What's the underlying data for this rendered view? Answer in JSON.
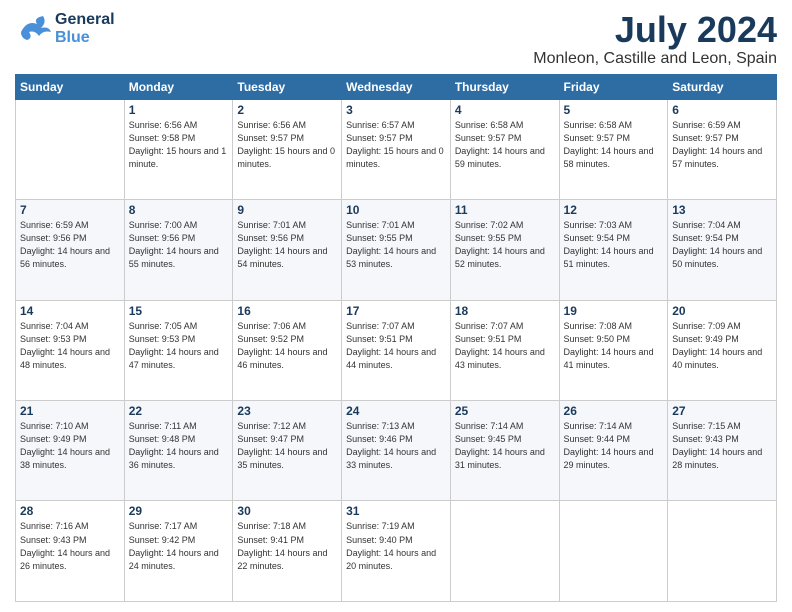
{
  "header": {
    "logo_general": "General",
    "logo_blue": "Blue",
    "month_year": "July 2024",
    "location": "Monleon, Castille and Leon, Spain"
  },
  "days_header": [
    "Sunday",
    "Monday",
    "Tuesday",
    "Wednesday",
    "Thursday",
    "Friday",
    "Saturday"
  ],
  "weeks": [
    [
      {
        "day": "",
        "sunrise": "",
        "sunset": "",
        "daylight": ""
      },
      {
        "day": "1",
        "sunrise": "Sunrise: 6:56 AM",
        "sunset": "Sunset: 9:58 PM",
        "daylight": "Daylight: 15 hours and 1 minute."
      },
      {
        "day": "2",
        "sunrise": "Sunrise: 6:56 AM",
        "sunset": "Sunset: 9:57 PM",
        "daylight": "Daylight: 15 hours and 0 minutes."
      },
      {
        "day": "3",
        "sunrise": "Sunrise: 6:57 AM",
        "sunset": "Sunset: 9:57 PM",
        "daylight": "Daylight: 15 hours and 0 minutes."
      },
      {
        "day": "4",
        "sunrise": "Sunrise: 6:58 AM",
        "sunset": "Sunset: 9:57 PM",
        "daylight": "Daylight: 14 hours and 59 minutes."
      },
      {
        "day": "5",
        "sunrise": "Sunrise: 6:58 AM",
        "sunset": "Sunset: 9:57 PM",
        "daylight": "Daylight: 14 hours and 58 minutes."
      },
      {
        "day": "6",
        "sunrise": "Sunrise: 6:59 AM",
        "sunset": "Sunset: 9:57 PM",
        "daylight": "Daylight: 14 hours and 57 minutes."
      }
    ],
    [
      {
        "day": "7",
        "sunrise": "Sunrise: 6:59 AM",
        "sunset": "Sunset: 9:56 PM",
        "daylight": "Daylight: 14 hours and 56 minutes."
      },
      {
        "day": "8",
        "sunrise": "Sunrise: 7:00 AM",
        "sunset": "Sunset: 9:56 PM",
        "daylight": "Daylight: 14 hours and 55 minutes."
      },
      {
        "day": "9",
        "sunrise": "Sunrise: 7:01 AM",
        "sunset": "Sunset: 9:56 PM",
        "daylight": "Daylight: 14 hours and 54 minutes."
      },
      {
        "day": "10",
        "sunrise": "Sunrise: 7:01 AM",
        "sunset": "Sunset: 9:55 PM",
        "daylight": "Daylight: 14 hours and 53 minutes."
      },
      {
        "day": "11",
        "sunrise": "Sunrise: 7:02 AM",
        "sunset": "Sunset: 9:55 PM",
        "daylight": "Daylight: 14 hours and 52 minutes."
      },
      {
        "day": "12",
        "sunrise": "Sunrise: 7:03 AM",
        "sunset": "Sunset: 9:54 PM",
        "daylight": "Daylight: 14 hours and 51 minutes."
      },
      {
        "day": "13",
        "sunrise": "Sunrise: 7:04 AM",
        "sunset": "Sunset: 9:54 PM",
        "daylight": "Daylight: 14 hours and 50 minutes."
      }
    ],
    [
      {
        "day": "14",
        "sunrise": "Sunrise: 7:04 AM",
        "sunset": "Sunset: 9:53 PM",
        "daylight": "Daylight: 14 hours and 48 minutes."
      },
      {
        "day": "15",
        "sunrise": "Sunrise: 7:05 AM",
        "sunset": "Sunset: 9:53 PM",
        "daylight": "Daylight: 14 hours and 47 minutes."
      },
      {
        "day": "16",
        "sunrise": "Sunrise: 7:06 AM",
        "sunset": "Sunset: 9:52 PM",
        "daylight": "Daylight: 14 hours and 46 minutes."
      },
      {
        "day": "17",
        "sunrise": "Sunrise: 7:07 AM",
        "sunset": "Sunset: 9:51 PM",
        "daylight": "Daylight: 14 hours and 44 minutes."
      },
      {
        "day": "18",
        "sunrise": "Sunrise: 7:07 AM",
        "sunset": "Sunset: 9:51 PM",
        "daylight": "Daylight: 14 hours and 43 minutes."
      },
      {
        "day": "19",
        "sunrise": "Sunrise: 7:08 AM",
        "sunset": "Sunset: 9:50 PM",
        "daylight": "Daylight: 14 hours and 41 minutes."
      },
      {
        "day": "20",
        "sunrise": "Sunrise: 7:09 AM",
        "sunset": "Sunset: 9:49 PM",
        "daylight": "Daylight: 14 hours and 40 minutes."
      }
    ],
    [
      {
        "day": "21",
        "sunrise": "Sunrise: 7:10 AM",
        "sunset": "Sunset: 9:49 PM",
        "daylight": "Daylight: 14 hours and 38 minutes."
      },
      {
        "day": "22",
        "sunrise": "Sunrise: 7:11 AM",
        "sunset": "Sunset: 9:48 PM",
        "daylight": "Daylight: 14 hours and 36 minutes."
      },
      {
        "day": "23",
        "sunrise": "Sunrise: 7:12 AM",
        "sunset": "Sunset: 9:47 PM",
        "daylight": "Daylight: 14 hours and 35 minutes."
      },
      {
        "day": "24",
        "sunrise": "Sunrise: 7:13 AM",
        "sunset": "Sunset: 9:46 PM",
        "daylight": "Daylight: 14 hours and 33 minutes."
      },
      {
        "day": "25",
        "sunrise": "Sunrise: 7:14 AM",
        "sunset": "Sunset: 9:45 PM",
        "daylight": "Daylight: 14 hours and 31 minutes."
      },
      {
        "day": "26",
        "sunrise": "Sunrise: 7:14 AM",
        "sunset": "Sunset: 9:44 PM",
        "daylight": "Daylight: 14 hours and 29 minutes."
      },
      {
        "day": "27",
        "sunrise": "Sunrise: 7:15 AM",
        "sunset": "Sunset: 9:43 PM",
        "daylight": "Daylight: 14 hours and 28 minutes."
      }
    ],
    [
      {
        "day": "28",
        "sunrise": "Sunrise: 7:16 AM",
        "sunset": "Sunset: 9:43 PM",
        "daylight": "Daylight: 14 hours and 26 minutes."
      },
      {
        "day": "29",
        "sunrise": "Sunrise: 7:17 AM",
        "sunset": "Sunset: 9:42 PM",
        "daylight": "Daylight: 14 hours and 24 minutes."
      },
      {
        "day": "30",
        "sunrise": "Sunrise: 7:18 AM",
        "sunset": "Sunset: 9:41 PM",
        "daylight": "Daylight: 14 hours and 22 minutes."
      },
      {
        "day": "31",
        "sunrise": "Sunrise: 7:19 AM",
        "sunset": "Sunset: 9:40 PM",
        "daylight": "Daylight: 14 hours and 20 minutes."
      },
      {
        "day": "",
        "sunrise": "",
        "sunset": "",
        "daylight": ""
      },
      {
        "day": "",
        "sunrise": "",
        "sunset": "",
        "daylight": ""
      },
      {
        "day": "",
        "sunrise": "",
        "sunset": "",
        "daylight": ""
      }
    ]
  ]
}
